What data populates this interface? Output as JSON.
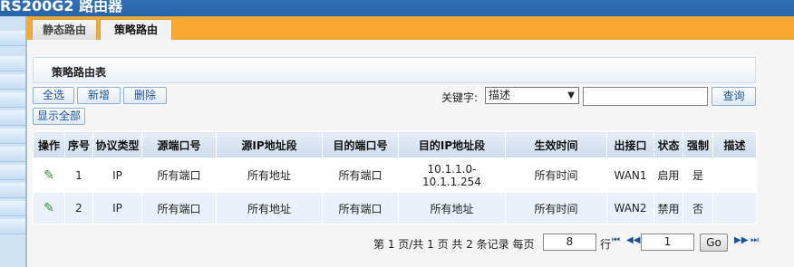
{
  "header": {
    "title": "RS200G2 路由器"
  },
  "tabs": [
    {
      "label": "静态路由",
      "active": false
    },
    {
      "label": "策略路由",
      "active": true
    }
  ],
  "panel": {
    "title": "策略路由表"
  },
  "toolbar": {
    "select_all": "全选",
    "add": "新增",
    "delete": "删除",
    "show_all": "显示全部",
    "keyword_label": "关键字:",
    "keyword_select": "描述",
    "search_value": "",
    "search_button": "查询"
  },
  "table": {
    "columns": [
      "操作",
      "序号",
      "协议类型",
      "源端口号",
      "源IP地址段",
      "目的端口号",
      "目的IP地址段",
      "生效时间",
      "出接口",
      "状态",
      "强制",
      "描述"
    ],
    "rows": [
      {
        "seq": "1",
        "protocol": "IP",
        "src_port": "所有端口",
        "src_ip": "所有地址",
        "dst_port": "所有端口",
        "dst_ip_1": "10.1.1.0-",
        "dst_ip_2": "10.1.1.254",
        "time": "所有时间",
        "iface": "WAN1",
        "status": "启用",
        "force": "是",
        "desc": ""
      },
      {
        "seq": "2",
        "protocol": "IP",
        "src_port": "所有端口",
        "src_ip": "所有地址",
        "dst_port": "所有端口",
        "dst_ip_1": "所有地址",
        "dst_ip_2": "",
        "time": "所有时间",
        "iface": "WAN2",
        "status": "禁用",
        "force": "否",
        "desc": ""
      }
    ]
  },
  "pagination": {
    "summary": "第 1 页/共 1 页 共 2 条记录 每页",
    "per_page": "8",
    "row_label": "行",
    "page_input": "1",
    "go": "Go"
  },
  "colors": {
    "header_blue": "#2f6fb4",
    "tab_orange": "#f8a830",
    "edit_green": "#2e8b2e"
  }
}
